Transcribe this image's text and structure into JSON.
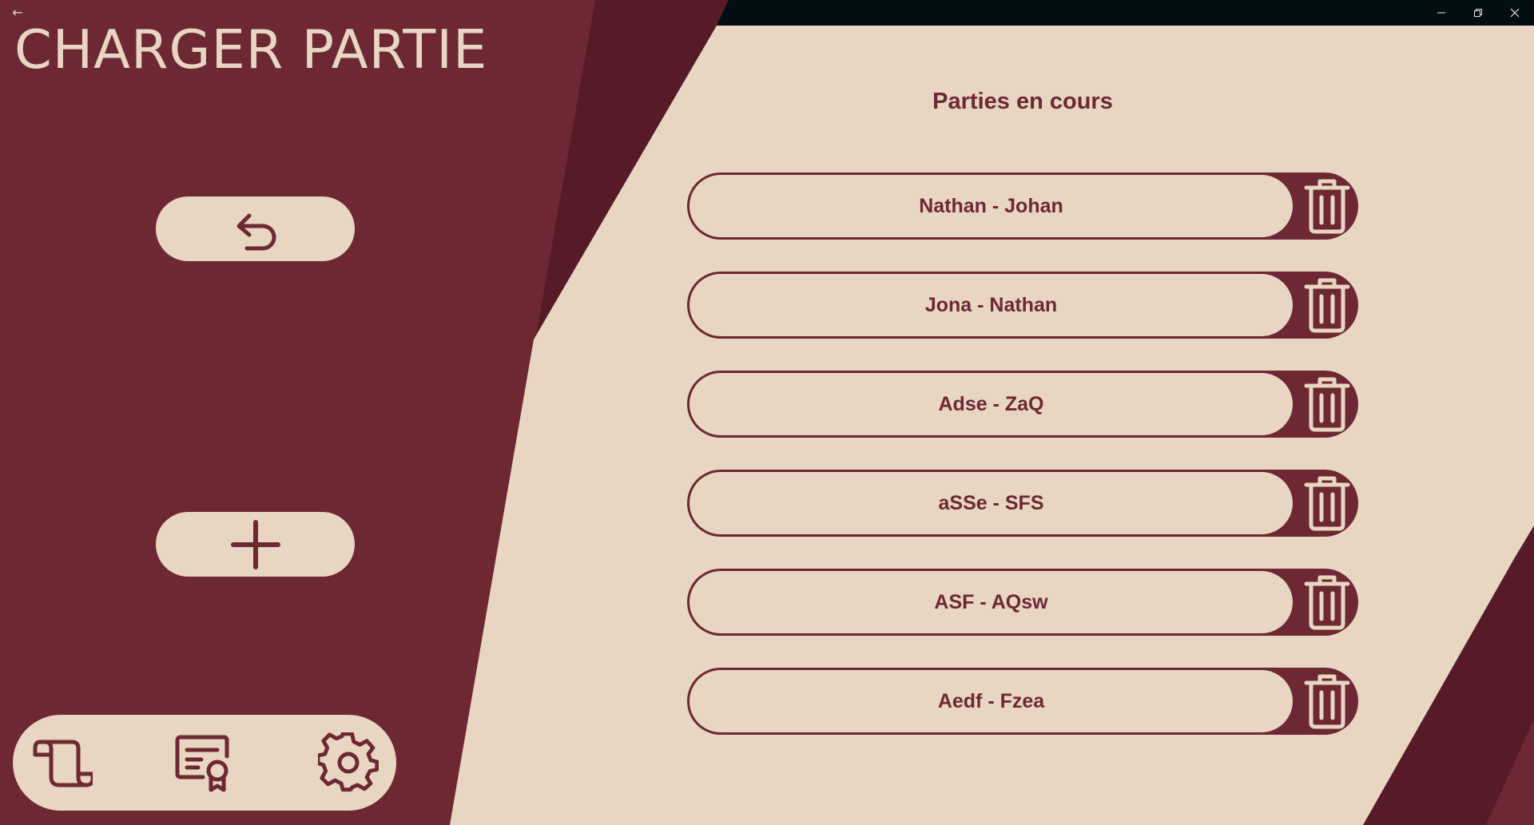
{
  "window": {
    "back_glyph": "←",
    "controls": [
      "minimize-icon",
      "restore-icon",
      "close-icon"
    ]
  },
  "header": {
    "title": "CHARGER PARTIE"
  },
  "left_actions": [
    {
      "icon": "undo-arrow-icon",
      "action": "back"
    },
    {
      "icon": "plus-icon",
      "action": "new-game"
    }
  ],
  "bottom_nav": [
    {
      "icon": "scroll-icon"
    },
    {
      "icon": "certificate-icon"
    },
    {
      "icon": "gear-icon"
    }
  ],
  "main": {
    "heading": "Parties en cours",
    "games": [
      {
        "name": "Nathan - Johan"
      },
      {
        "name": "Jona - Nathan"
      },
      {
        "name": "Adse - ZaQ"
      },
      {
        "name": "aSSe - SFS"
      },
      {
        "name": "ASF - AQsw"
      },
      {
        "name": "Aedf - Fzea"
      }
    ],
    "delete_icon": "trash-icon"
  },
  "colors": {
    "primary": "#6d2833",
    "dark": "#561b27",
    "cream": "#e8d6c2",
    "titlebar": "#020d14"
  }
}
